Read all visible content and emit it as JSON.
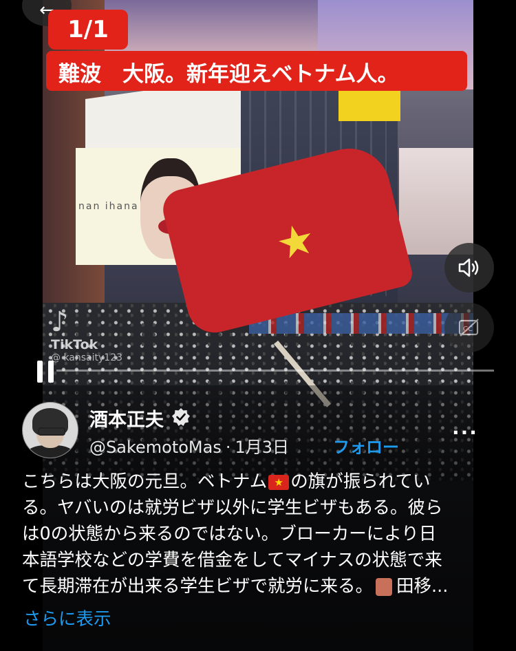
{
  "overlay": {
    "count": "1/1",
    "title": "難波　大阪。新年迎えベトナム人。",
    "billboard_text": "nan ihana",
    "watermark": {
      "brand": "TikTok",
      "user": "@ kansaity123"
    }
  },
  "controls": {
    "back_icon": "arrow-left-icon",
    "volume_icon": "speaker-icon",
    "captions_icon": "captions-off-icon",
    "pause_icon": "pause-icon",
    "progress": 0.0
  },
  "post": {
    "display_name": "酒本正夫",
    "handle": "@SakemotoMas",
    "separator": "·",
    "date": "1月3日",
    "follow_label": "フォロー",
    "more_label": "···",
    "text_lines": [
      {
        "before": "こちらは大阪の元旦。ベトナム",
        "flag": "★",
        "after": "の旗が振られてい"
      },
      "る。ヤバいのは就労ビザ以外に学生ビザもある。彼ら",
      "は0の状態から来るのではない。ブローカーにより日",
      "本語学校などの学費を借金をしてマイナスの状態で来",
      {
        "before": "て長期滞在が出来る学生ビザで就労に来る。",
        "after": "田移..."
      }
    ],
    "see_more": "さらに表示"
  },
  "colors": {
    "accent_red": "#e2231a",
    "link_blue": "#1d9bf0"
  }
}
